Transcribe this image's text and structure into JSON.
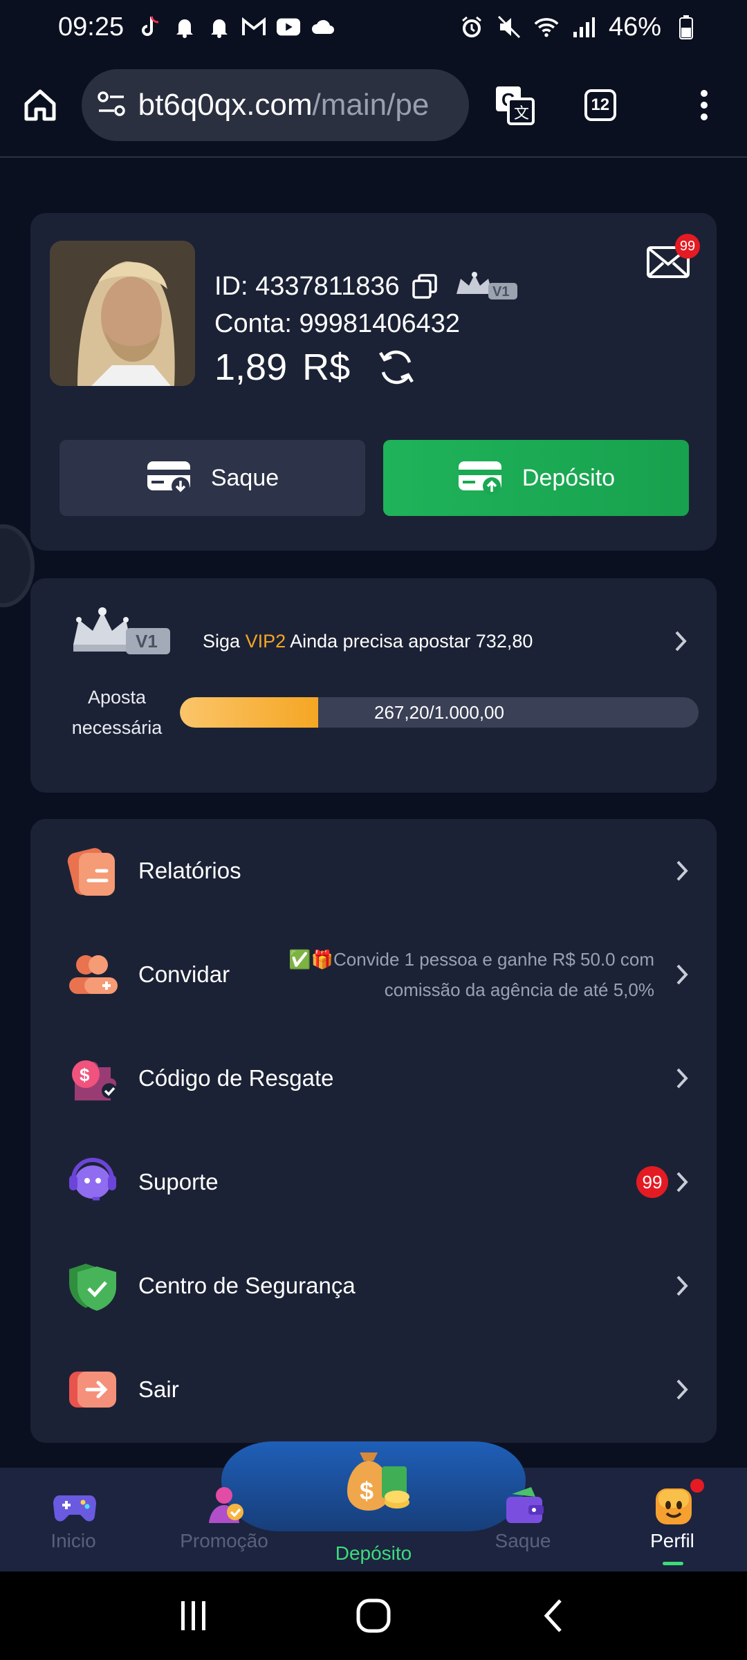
{
  "status_bar": {
    "time": "09:25",
    "battery": "46%"
  },
  "browser": {
    "url_domain": "bt6q0qx.com",
    "url_path": "/main/pe",
    "tabs_count": "12"
  },
  "profile": {
    "id_label": "ID: 4337811836",
    "vip_level": "V1",
    "account_label": "Conta: 99981406432",
    "balance": "1,89",
    "currency": "R$",
    "mail_badge": "99"
  },
  "actions": {
    "withdraw_label": "Saque",
    "deposit_label": "Depósito"
  },
  "vip": {
    "level": "V1",
    "text_prefix": "Siga",
    "next_level": "VIP2",
    "text_suffix": "Ainda precisa apostar 732,80",
    "need_label_1": "Aposta",
    "need_label_2": "necessária",
    "progress_text": "267,20/1.000,00",
    "progress_fraction": 0.2672
  },
  "menu": {
    "items": [
      {
        "label": "Relatórios"
      },
      {
        "label": "Convidar",
        "desc_line1": "✅🎁Convide 1 pessoa e ganhe R$ 50.0 com",
        "desc_line2": "comissão da agência de até 5,0%"
      },
      {
        "label": "Código de Resgate"
      },
      {
        "label": "Suporte",
        "badge": "99"
      },
      {
        "label": "Centro de Segurança"
      },
      {
        "label": "Sair"
      }
    ]
  },
  "bottom_nav": {
    "items": [
      {
        "label": "Inicio"
      },
      {
        "label": "Promoção"
      },
      {
        "label": "Depósito"
      },
      {
        "label": "Saque"
      },
      {
        "label": "Perfil"
      }
    ]
  },
  "colors": {
    "background": "#0b1020",
    "card": "#1c2235",
    "accent_green": "#1fb35a",
    "accent_gold": "#f6a623",
    "badge_red": "#e41b23"
  }
}
